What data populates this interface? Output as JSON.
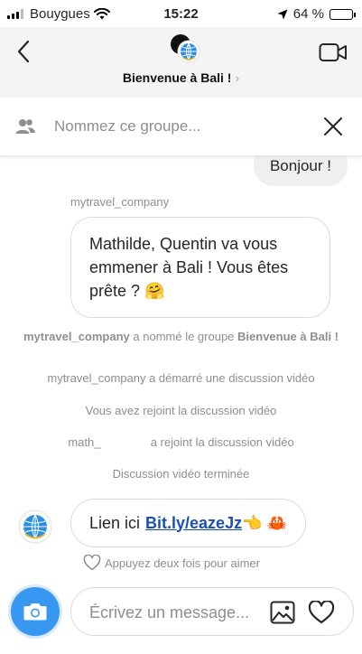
{
  "status_bar": {
    "carrier": "Bouygues",
    "time": "15:22",
    "battery_text": "64 %",
    "battery_level": 0.64
  },
  "header": {
    "group_title": "Bienvenue à Bali !",
    "title_chevron": "›"
  },
  "name_bar": {
    "placeholder": "Nommez ce groupe..."
  },
  "messages": {
    "outgoing_partial": "Bonjour !",
    "sender_label": "mytravel_company",
    "incoming_text": "Mathilde, Quentin va vous emmener à Bali ! Vous êtes prête ? 🤗",
    "sys_named_user": "mytravel_company",
    "sys_named_text": "a nommé le groupe",
    "sys_named_group": "Bienvenue à Bali !",
    "sys_started": "mytravel_company a démarré une discussion vidéo",
    "sys_you_joined": "Vous avez rejoint la discussion vidéo",
    "sys_user_joined_name": "math_",
    "sys_user_joined_text": "a rejoint la discussion vidéo",
    "sys_ended": "Discussion vidéo terminée",
    "link_prefix": "Lien ici",
    "link_text": "Bit.ly/eazeJz",
    "link_suffix": "👈 🦀",
    "like_hint": "Appuyez deux fois pour aimer"
  },
  "composer": {
    "placeholder": "Écrivez un message..."
  },
  "colors": {
    "accent": "#3897f0",
    "link": "#1a4fb3",
    "muted": "#8e8e8e"
  }
}
